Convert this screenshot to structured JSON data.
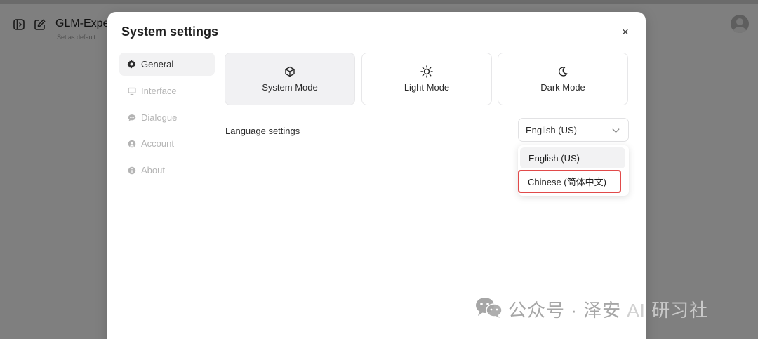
{
  "background": {
    "app_title": "GLM-Expe",
    "app_subtitle": "Set as default"
  },
  "modal": {
    "title": "System settings",
    "close_label": "×"
  },
  "sidebar": {
    "items": [
      {
        "label": "General",
        "icon": "gear-icon",
        "active": true
      },
      {
        "label": "Interface",
        "icon": "monitor-icon",
        "active": false
      },
      {
        "label": "Dialogue",
        "icon": "chat-bubble-icon",
        "active": false
      },
      {
        "label": "Account",
        "icon": "user-circle-icon",
        "active": false
      },
      {
        "label": "About",
        "icon": "info-icon",
        "active": false
      }
    ]
  },
  "modes": [
    {
      "label": "System Mode",
      "icon": "cube-icon",
      "active": true
    },
    {
      "label": "Light Mode",
      "icon": "sun-icon",
      "active": false
    },
    {
      "label": "Dark Mode",
      "icon": "moon-icon",
      "active": false
    }
  ],
  "language": {
    "label": "Language settings",
    "selected": "English (US)",
    "options": [
      "English (US)",
      "Chinese (简体中文)"
    ],
    "highlighted_option": "Chinese (简体中文)"
  },
  "watermark": {
    "text_main": "公众号 · 泽安",
    "text_tail": " AI 研习社"
  },
  "colors": {
    "highlight_border": "#e14a4a",
    "overlay": "#000000",
    "active_bg": "#f2f2f3"
  }
}
